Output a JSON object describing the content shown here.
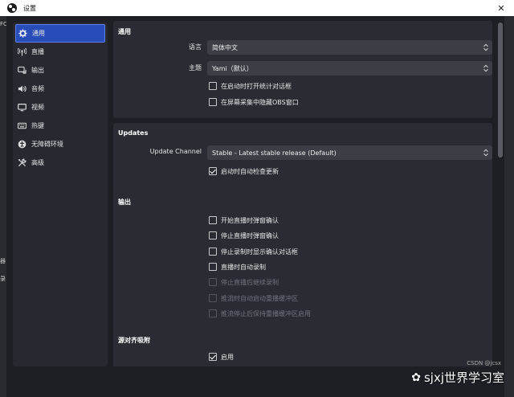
{
  "window": {
    "title": "设置",
    "close": "✕"
  },
  "sidebar": {
    "items": [
      {
        "label": "通用",
        "icon": "gear-icon",
        "active": true
      },
      {
        "label": "直播",
        "icon": "antenna-icon"
      },
      {
        "label": "输出",
        "icon": "output-icon"
      },
      {
        "label": "音频",
        "icon": "speaker-icon"
      },
      {
        "label": "视频",
        "icon": "monitor-icon"
      },
      {
        "label": "热键",
        "icon": "keyboard-icon"
      },
      {
        "label": "无障碍环境",
        "icon": "accessibility-icon"
      },
      {
        "label": "高级",
        "icon": "tools-icon"
      }
    ]
  },
  "general": {
    "title": "通用",
    "language_label": "语言",
    "language_value": "简体中文",
    "theme_label": "主题",
    "theme_value": "Yami（默认）",
    "open_stats_on_start": "在启动时打开统计对话框",
    "hide_obs_on_capture": "在屏幕采集中隐藏OBS窗口"
  },
  "updates": {
    "title": "Updates",
    "channel_label": "Update Channel",
    "channel_value": "Stable - Latest stable release (Default)",
    "auto_check": "启动时自动检查更新"
  },
  "output": {
    "title": "输出",
    "confirm_start_stream": "开始直播时弹窗确认",
    "confirm_stop_stream": "停止直播时弹窗确认",
    "confirm_stop_record": "停止录制时显示确认对话框",
    "auto_record_when_streaming": "直播时自动录制",
    "keep_recording_after_stream": "停止直播后继续录制",
    "replay_buffer_on_stream": "推流时自动启动重播缓冲区",
    "keep_replay_buffer_after_stream": "推流停止后保持重播缓冲区启用"
  },
  "snapping": {
    "title": "源对齐吸附",
    "enable": "启用"
  },
  "watermark": {
    "text": "sjxj世界学习室",
    "sub": "CSDN @jcsx"
  },
  "background": {
    "left_frags": [
      "FC",
      "器",
      "录"
    ]
  }
}
